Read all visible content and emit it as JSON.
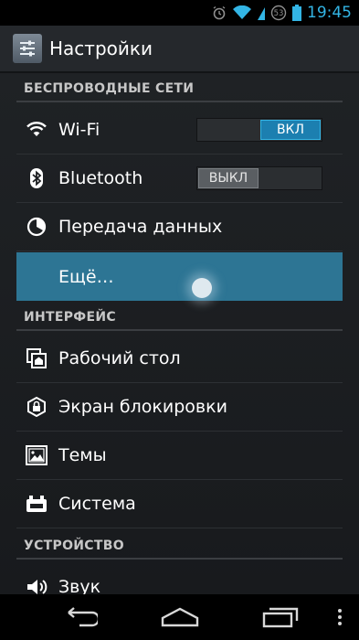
{
  "status_bar": {
    "time": "19:45",
    "badge": "53"
  },
  "action_bar": {
    "title": "Настройки"
  },
  "sections": {
    "wireless": "БЕСПРОВОДНЫЕ СЕТИ",
    "interface": "ИНТЕРФЕЙС",
    "device": "УСТРОЙСТВО"
  },
  "items": {
    "wifi": {
      "label": "Wi-Fi",
      "toggle": "ВКЛ"
    },
    "bluetooth": {
      "label": "Bluetooth",
      "toggle": "ВЫКЛ"
    },
    "data": {
      "label": "Передача данных"
    },
    "more": {
      "label": "Ещё…"
    },
    "desktop": {
      "label": "Рабочий стол"
    },
    "lockscreen": {
      "label": "Экран блокировки"
    },
    "themes": {
      "label": "Темы"
    },
    "system": {
      "label": "Система"
    },
    "sound": {
      "label": "Звук"
    }
  },
  "colors": {
    "accent": "#33b5e5",
    "selected": "#2d7594"
  },
  "icons": {
    "status": [
      "alarm-icon",
      "wifi-signal-icon",
      "data-badge-icon"
    ],
    "nav": [
      "back-icon",
      "home-icon",
      "recent-apps-icon",
      "overflow-menu-icon"
    ]
  }
}
